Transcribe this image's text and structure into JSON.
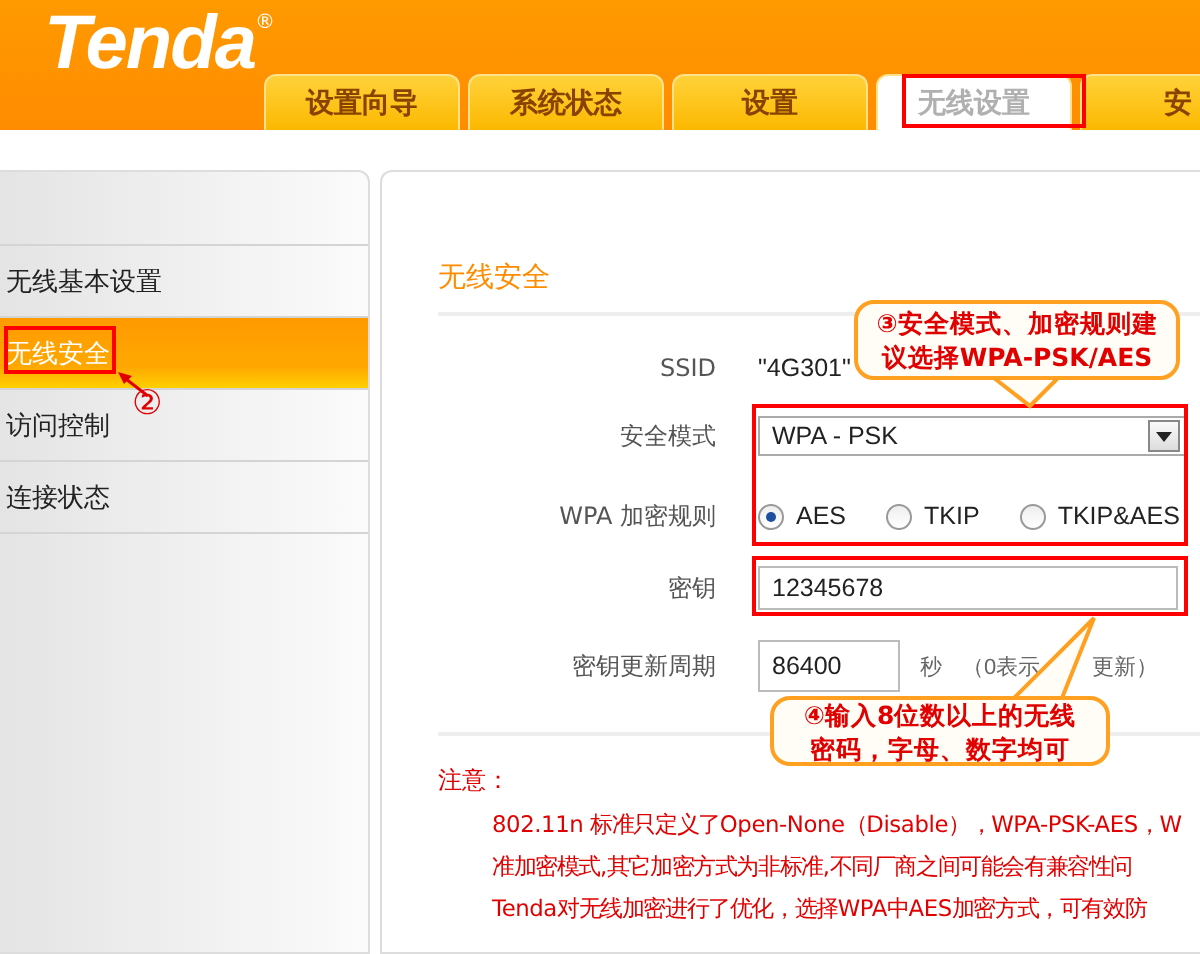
{
  "brand": {
    "logo": "Tenda",
    "mark": "®"
  },
  "tabs": [
    {
      "label": "设置向导",
      "selected": false
    },
    {
      "label": "系统状态",
      "selected": false
    },
    {
      "label": "设置",
      "selected": false
    },
    {
      "label": "无线设置",
      "selected": true
    },
    {
      "label": "安",
      "selected": false
    }
  ],
  "sidebar": {
    "items": [
      {
        "label": "无线基本设置",
        "selected": false
      },
      {
        "label": "无线安全",
        "selected": true
      },
      {
        "label": "访问控制",
        "selected": false
      },
      {
        "label": "连接状态",
        "selected": false
      }
    ]
  },
  "content": {
    "title": "无线安全",
    "fields": [
      {
        "kind": "static",
        "label": "SSID",
        "value": "\"4G301\""
      },
      {
        "kind": "select",
        "label": "安全模式",
        "value": "WPA - PSK"
      },
      {
        "kind": "radio",
        "label": "WPA 加密规则",
        "options": [
          {
            "label": "AES",
            "selected": true
          },
          {
            "label": "TKIP",
            "selected": false
          },
          {
            "label": "TKIP&AES",
            "selected": false
          }
        ]
      },
      {
        "kind": "input",
        "label": "密钥",
        "value": "12345678"
      },
      {
        "kind": "input",
        "label": "密钥更新周期",
        "value": "86400",
        "unit": "秒",
        "hint": [
          "（0表示",
          "更新）"
        ]
      }
    ]
  },
  "note": {
    "title": "注意：",
    "lines": [
      "802.11n 标准只定义了Open-None（Disable），WPA-PSK-AES，W",
      "准加密模式,其它加密方式为非标准,不同厂商之间可能会有兼容性问",
      "Tenda对无线加密进行了优化，选择WPA中AES加密方式，可有效防"
    ]
  },
  "annotations": [
    {
      "kind": "frame"
    },
    {
      "kind": "marker",
      "text": "②"
    },
    {
      "kind": "frame"
    },
    {
      "kind": "frame"
    },
    {
      "kind": "callout",
      "lines": [
        "③安全模式、加密规则建",
        "议选择WPA-PSK/AES"
      ]
    },
    {
      "kind": "callout",
      "lines": [
        "④输入8位数以上的无线",
        "密码，字母、数字均可"
      ]
    },
    {
      "kind": "frame"
    }
  ]
}
